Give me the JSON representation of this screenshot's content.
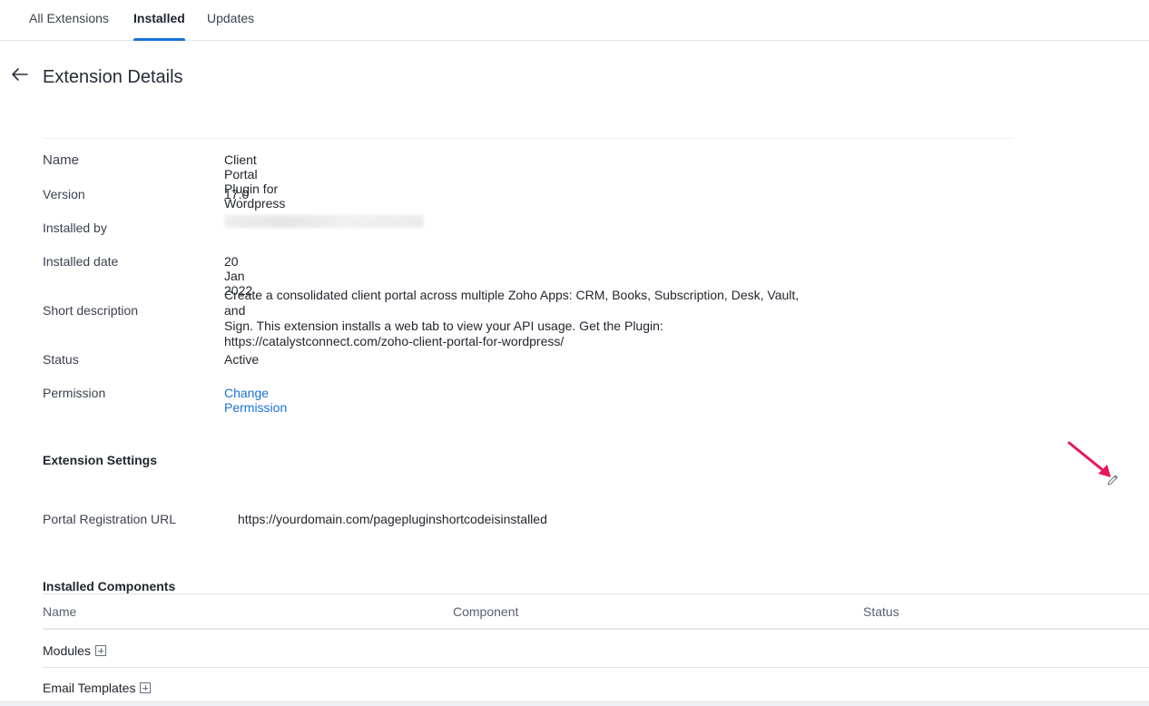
{
  "tabs": [
    {
      "label": "All Extensions"
    },
    {
      "label": "Installed"
    },
    {
      "label": "Updates"
    }
  ],
  "page_title": "Extension Details",
  "details": {
    "name_label": "Name",
    "name_value": "Client Portal Plugin for Wordpress",
    "version_label": "Version",
    "version_value": "17.0",
    "installed_by_label": "Installed by",
    "installed_date_label": "Installed date",
    "installed_date_value": "20 Jan 2022",
    "short_desc_label": "Short description",
    "short_desc_line1": "Create a consolidated client portal across multiple Zoho Apps: CRM, Books, Subscription, Desk, Vault, and",
    "short_desc_line2": "Sign. This extension installs a web tab to view your API usage. Get the Plugin:",
    "short_desc_line3": "https://catalystconnect.com/zoho-client-portal-for-wordpress/",
    "status_label": "Status",
    "status_value": "Active",
    "permission_label": "Permission",
    "permission_link": "Change Permission"
  },
  "settings": {
    "title": "Extension Settings",
    "portal_url_label": "Portal Registration URL",
    "portal_url_value": "https://yourdomain.com/pagepluginshortcodeisinstalled"
  },
  "components": {
    "title": "Installed Components",
    "headers": [
      "Name",
      "Component",
      "Status"
    ],
    "rows": [
      {
        "name": "Modules"
      },
      {
        "name": "Email Templates"
      }
    ]
  },
  "colors": {
    "accent": "#1a72d8",
    "annotation": "#e8185a"
  },
  "icons": {
    "back": "arrow-left-icon",
    "edit": "pencil-icon",
    "expand": "plus-square-icon"
  }
}
